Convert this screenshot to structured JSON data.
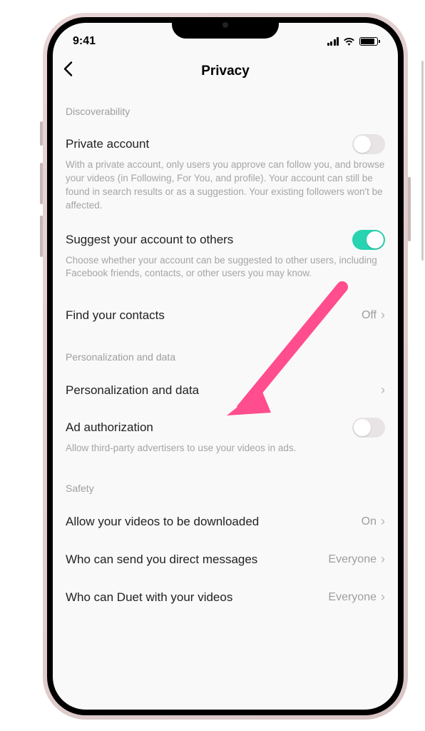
{
  "status": {
    "time": "9:41"
  },
  "header": {
    "title": "Privacy"
  },
  "sections": {
    "discoverability": {
      "label": "Discoverability",
      "private_account": {
        "title": "Private account",
        "desc": "With a private account, only users you approve can follow you, and browse your videos (in Following, For You, and profile). Your account can still be found in search results or as a suggestion. Your existing followers won't be affected.",
        "on": false
      },
      "suggest": {
        "title": "Suggest your account to others",
        "desc": "Choose whether your account can be suggested to other users, including Facebook friends, contacts, or other users you may know.",
        "on": true
      },
      "find_contacts": {
        "title": "Find your contacts",
        "value": "Off"
      }
    },
    "personalization": {
      "label": "Personalization and data",
      "row": {
        "title": "Personalization and data"
      },
      "ad_auth": {
        "title": "Ad authorization",
        "desc": "Allow third-party advertisers to use your videos in ads.",
        "on": false
      }
    },
    "safety": {
      "label": "Safety",
      "download": {
        "title": "Allow your videos to be downloaded",
        "value": "On"
      },
      "dm": {
        "title": "Who can send you direct messages",
        "value": "Everyone"
      },
      "duet": {
        "title": "Who can Duet with your videos",
        "value": "Everyone"
      }
    }
  }
}
